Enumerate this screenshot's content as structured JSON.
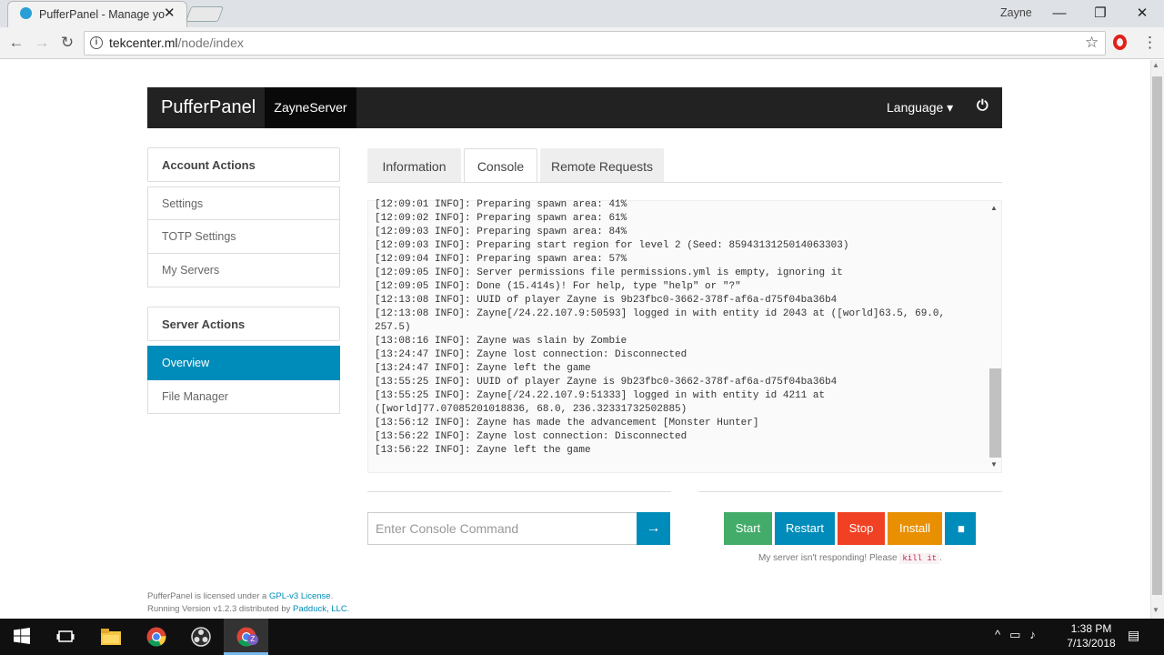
{
  "browser": {
    "tab_title": "PufferPanel - Manage yo",
    "tab_close": "✕",
    "profile": "Zayne",
    "window": {
      "minimize": "—",
      "restore": "❐",
      "close": "✕"
    },
    "url_host": "tekcenter.ml",
    "url_path": "/node/index",
    "nav": {
      "back": "←",
      "forward": "→",
      "reload": "↻"
    },
    "icons": {
      "info": "i",
      "star": "☆",
      "menu": "⋮"
    }
  },
  "navbar": {
    "brand": "PufferPanel",
    "server": "ZayneServer",
    "language": "Language ▾",
    "power": "⏻"
  },
  "sidebar": {
    "account_header": "Account Actions",
    "account_items": [
      "Settings",
      "TOTP Settings",
      "My Servers"
    ],
    "server_header": "Server Actions",
    "server_items": [
      "Overview",
      "File Manager"
    ]
  },
  "tabs": [
    "Information",
    "Console",
    "Remote Requests"
  ],
  "console": {
    "lines": "[12:09:01 INFO]: Preparing spawn area: 41%\n[12:09:02 INFO]: Preparing spawn area: 61%\n[12:09:03 INFO]: Preparing spawn area: 84%\n[12:09:03 INFO]: Preparing start region for level 2 (Seed: 8594313125014063303)\n[12:09:04 INFO]: Preparing spawn area: 57%\n[12:09:05 INFO]: Server permissions file permissions.yml is empty, ignoring it\n[12:09:05 INFO]: Done (15.414s)! For help, type \"help\" or \"?\"\n[12:13:08 INFO]: UUID of player Zayne is 9b23fbc0-3662-378f-af6a-d75f04ba36b4\n[12:13:08 INFO]: Zayne[/24.22.107.9:50593] logged in with entity id 2043 at ([world]63.5, 69.0, 257.5)\n[13:08:16 INFO]: Zayne was slain by Zombie\n[13:24:47 INFO]: Zayne lost connection: Disconnected\n[13:24:47 INFO]: Zayne left the game\n[13:55:25 INFO]: UUID of player Zayne is 9b23fbc0-3662-378f-af6a-d75f04ba36b4\n[13:55:25 INFO]: Zayne[/24.22.107.9:51333] logged in with entity id 4211 at ([world]77.07085201018836, 68.0, 236.32331732502885)\n[13:56:12 INFO]: Zayne has made the advancement [Monster Hunter]\n[13:56:22 INFO]: Zayne lost connection: Disconnected\n[13:56:22 INFO]: Zayne left the game",
    "scroll_up": "▲",
    "scroll_down": "▼"
  },
  "command": {
    "placeholder": "Enter Console Command",
    "send": "→"
  },
  "controls": {
    "start": "Start",
    "restart": "Restart",
    "stop": "Stop",
    "install": "Install",
    "pause": "▮▮"
  },
  "kill": {
    "prefix": "My server isn't responding! Please",
    "code": "kill it",
    "suffix": "."
  },
  "footer": {
    "line1_prefix": "PufferPanel is licensed under a ",
    "license": "GPL-v3 License",
    "line1_suffix": ".",
    "line2_prefix": "Running Version v1.2.3 distributed by ",
    "company": "Padduck, LLC",
    "line2_suffix": "."
  },
  "colors": {
    "primary": "#008cba",
    "success": "#43ac6a",
    "danger": "#f04124",
    "warning": "#e99002",
    "navbar": "#222222"
  },
  "taskbar": {
    "time": "1:38 PM",
    "date": "7/13/2018",
    "chrome_profile_badge": "Z"
  }
}
